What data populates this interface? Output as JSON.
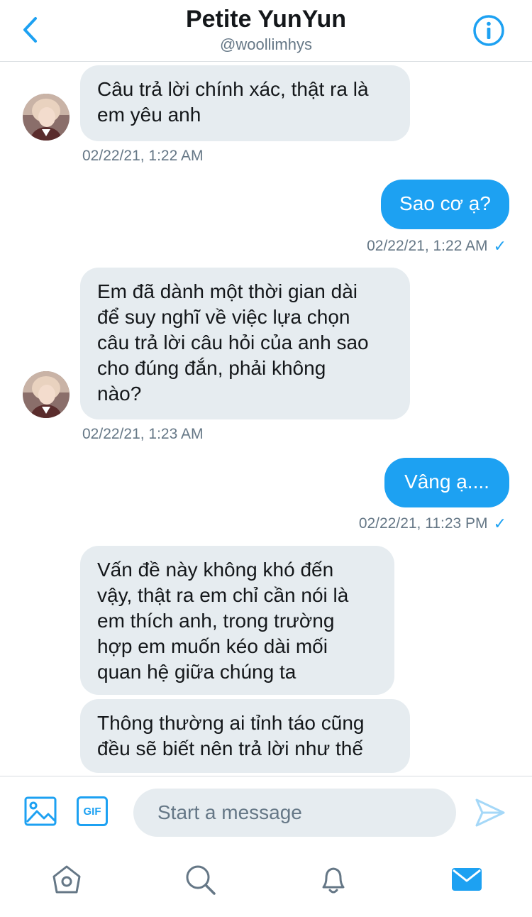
{
  "header": {
    "title": "Petite YunYun",
    "handle": "@woollimhys"
  },
  "messages": [
    {
      "direction": "in",
      "lines": [
        "Câu trả lời chính xác, thật ra là",
        "em yêu anh"
      ],
      "timestamp": "02/22/21, 1:22 AM"
    },
    {
      "direction": "out",
      "text": "Sao cơ ạ?",
      "timestamp": "02/22/21, 1:22 AM"
    },
    {
      "direction": "in",
      "lines": [
        "Em đã dành một thời gian dài",
        "để suy nghĩ về việc lựa chọn",
        "câu trả lời câu hỏi của anh sao",
        "cho đúng đắn, phải không",
        "nào?"
      ],
      "timestamp": "02/22/21, 1:23 AM"
    },
    {
      "direction": "out",
      "text": "Vâng ạ....",
      "timestamp": "02/22/21, 11:23 PM"
    },
    {
      "direction": "in",
      "lines": [
        "Vấn đề này không khó đến",
        "vậy, thật ra em chỉ cần nói là",
        "em thích anh, trong trường",
        "hợp em muốn kéo dài mối",
        "quan hệ giữa chúng ta"
      ]
    },
    {
      "direction": "in",
      "lines": [
        "Thông thường ai tỉnh táo cũng",
        "đều sẽ biết nên trả lời như thế"
      ]
    }
  ],
  "composer": {
    "gif_label": "GIF",
    "placeholder": "Start a message"
  },
  "tabs": [
    "home-icon",
    "search-icon",
    "notifications-icon",
    "messages-icon"
  ],
  "colors": {
    "accent": "#1da1f2",
    "bubble_in": "#e6ecf0",
    "secondary_text": "#657786"
  }
}
